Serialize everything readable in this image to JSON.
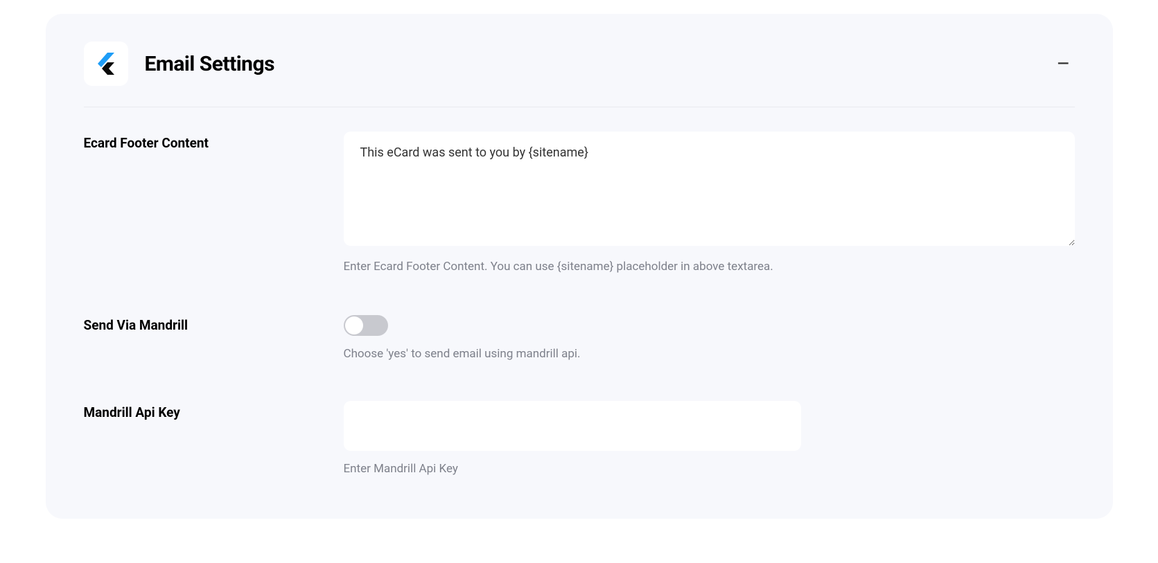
{
  "panel": {
    "title": "Email Settings"
  },
  "fields": {
    "ecard_footer": {
      "label": "Ecard Footer Content",
      "value": "This eCard was sent to you by {sitename}",
      "help": "Enter Ecard Footer Content. You can use {sitename} placeholder in above textarea."
    },
    "send_via_mandrill": {
      "label": "Send Via Mandrill",
      "checked": false,
      "help": "Choose 'yes' to send email using mandrill api."
    },
    "mandrill_api_key": {
      "label": "Mandrill Api Key",
      "value": "",
      "help": "Enter Mandrill Api Key"
    }
  }
}
